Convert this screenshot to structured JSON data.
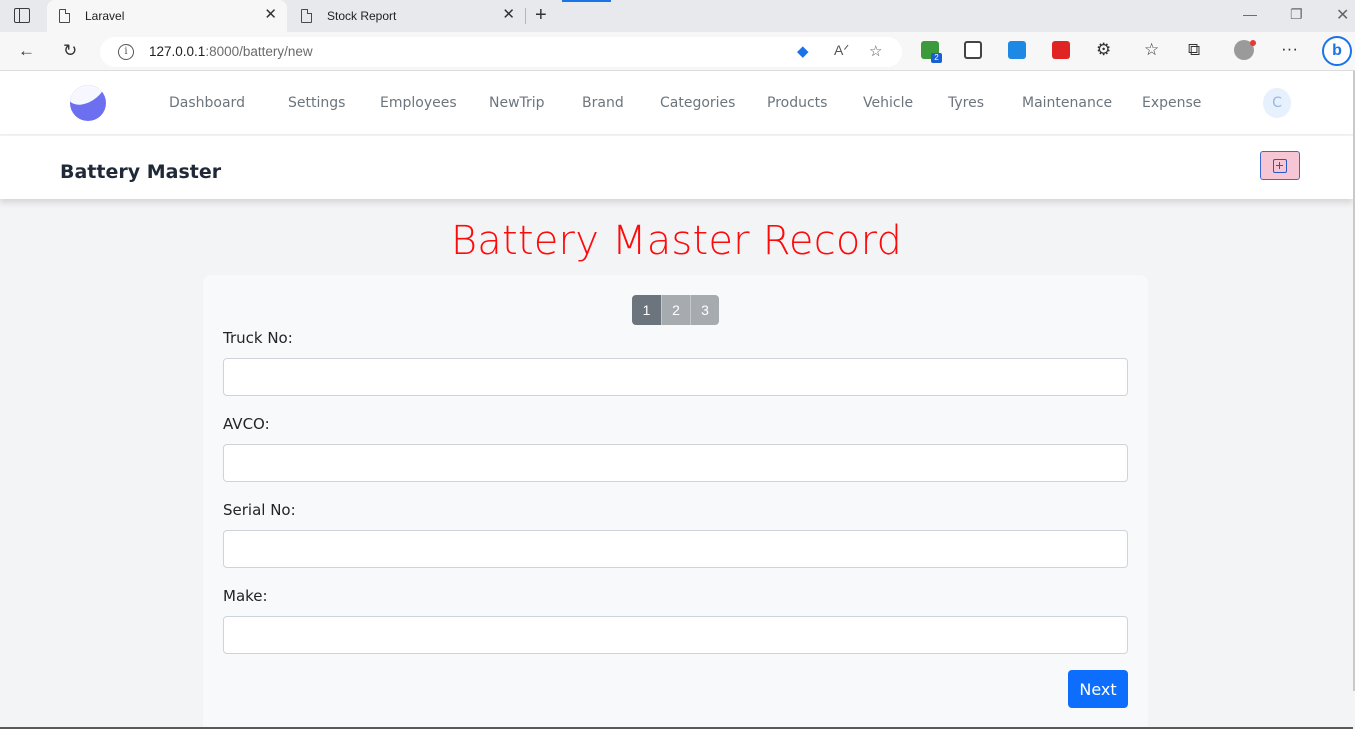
{
  "browser": {
    "tabs": [
      {
        "title": "Laravel",
        "active": true
      },
      {
        "title": "Stock Report",
        "active": false
      }
    ],
    "url_host": "127.0.0.1",
    "url_rest": ":8000/battery/new",
    "icons": [
      "tab-actions-icon",
      "page-icon",
      "close-icon",
      "new-tab-icon",
      "minimize-icon",
      "restore-icon",
      "window-close-icon",
      "back-icon",
      "refresh-icon",
      "info-icon",
      "tag-icon",
      "read-aloud-icon",
      "add-favorite-icon",
      "extension-icons",
      "favorites-icon",
      "collections-icon",
      "profile-icon",
      "more-icon",
      "bing-icon"
    ],
    "extension_badge": "2"
  },
  "nav": {
    "links": [
      "Dashboard",
      "Settings",
      "Employees",
      "NewTrip",
      "Brand",
      "Categories",
      "Products",
      "Vehicle",
      "Tyres",
      "Maintenance",
      "Expense"
    ],
    "avatar_initial": "C",
    "logo_color": "#6b6ff0"
  },
  "header": {
    "title": "Battery Master"
  },
  "main": {
    "title": "Battery Master Record",
    "title_color": "#ff0a0a",
    "steps": [
      "1",
      "2",
      "3"
    ],
    "active_step": "1",
    "fields": [
      {
        "label": "Truck No:",
        "value": ""
      },
      {
        "label": "AVCO:",
        "value": ""
      },
      {
        "label": "Serial No:",
        "value": ""
      },
      {
        "label": "Make:",
        "value": ""
      }
    ],
    "next_label": "Next",
    "next_color": "#0d6efd"
  }
}
